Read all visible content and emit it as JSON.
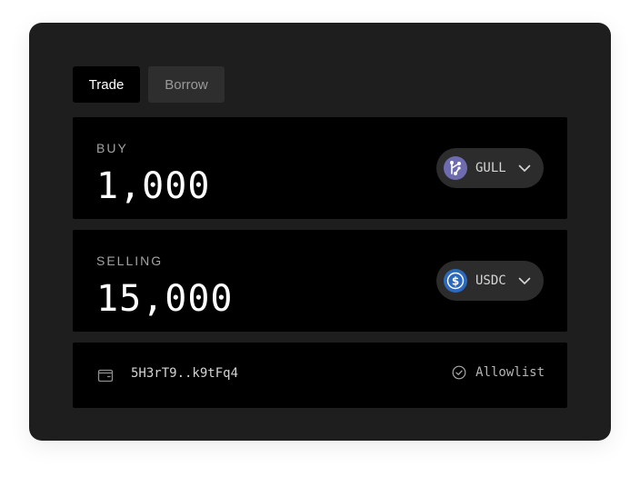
{
  "tabs": [
    {
      "label": "Trade",
      "active": true
    },
    {
      "label": "Borrow",
      "active": false
    }
  ],
  "buy": {
    "label": "BUY",
    "amount": "1,000",
    "token": {
      "symbol": "GULL",
      "icon": "gull-token-icon",
      "color": "#6f6bb0"
    }
  },
  "sell": {
    "label": "SELLING",
    "amount": "15,000",
    "token": {
      "symbol": "USDC",
      "icon": "usdc-token-icon",
      "color": "#2d69bb"
    }
  },
  "wallet": {
    "icon": "wallet-icon",
    "address": "5H3rT9..k9tFq4",
    "status_icon": "check-circle-icon",
    "status_label": "Allowlist"
  },
  "colors": {
    "card_background": "#1e1e1e",
    "panel_background": "#000000",
    "token_pill": "#2c2c2c"
  }
}
